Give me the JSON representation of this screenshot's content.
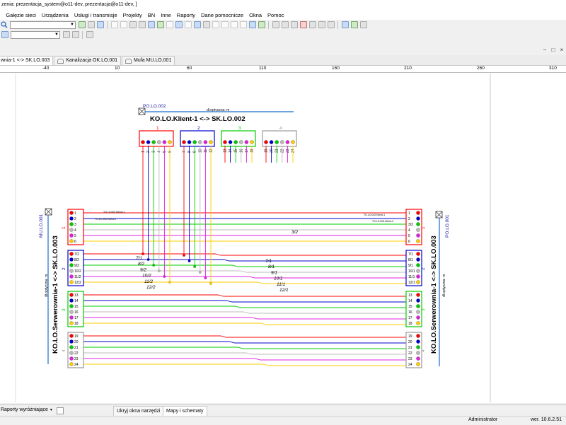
{
  "window": {
    "title": "zenia: prezentacja_system@o11-dev, prezentacja@o11-dev, ]"
  },
  "menu": [
    "ji",
    "Gałęzie sieci",
    "Urządzenia",
    "Usługi i transmisje",
    "Projekty",
    "BN",
    "Inne",
    "Raporty",
    "Dane pomocnicze",
    "Okna",
    "Pomoc"
  ],
  "tabs": [
    {
      "label": "wnia-1 <-> SK.LO.003"
    },
    {
      "label": "Kanalizacja OK.LO.001"
    },
    {
      "label": "Mufa MU.LO.001"
    }
  ],
  "ruler": [
    "-40",
    "10",
    "60",
    "110",
    "160",
    "210",
    "260",
    "310"
  ],
  "diagram": {
    "top_po": "PO.LO.002",
    "top_cable_note": "dł.optyczna: m",
    "top_cable_name": "KO.LO.Klient-1 <-> SK.LO.002",
    "top_tubes": [
      {
        "label": "1",
        "color": "#ff0000",
        "fibers": [
          "1",
          "2",
          "3",
          "4",
          "5",
          "6"
        ]
      },
      {
        "label": "2",
        "color": "#0000cc",
        "fibers": [
          "7",
          "8",
          "9",
          "10",
          "11",
          "12"
        ]
      },
      {
        "label": "3",
        "color": "#00cc00",
        "fibers": [
          "13",
          "14",
          "15",
          "16",
          "17",
          "18"
        ]
      },
      {
        "label": "4",
        "color": "#999999",
        "fibers": [
          "19",
          "20",
          "21",
          "22",
          "23",
          "24"
        ]
      }
    ],
    "left_mu": "MU.LO.001",
    "left_note": "dł.optyczna: m",
    "left_cable_name": "KO.LO.Serwerownia-1 <-> SK.LO.003",
    "right_po": "PO.LO.001",
    "right_note": "dł.optyczna: m",
    "right_cable_name": "KO.LO.Serwerownia-1 <-> SK.LO.003",
    "left_tubes": [
      {
        "label": "1",
        "color": "#ff0000",
        "fibers": [
          "1",
          "2",
          "3",
          "4",
          "5",
          "6"
        ],
        "side": "3/2"
      },
      {
        "label": "2",
        "color": "#0000cc",
        "fibers": [
          "7/2",
          "8/2",
          "9/2",
          "10/2",
          "11/2",
          "12/2"
        ],
        "side": "7/2 8/2 9/2 10/2 11/2 12/2"
      },
      {
        "label": "3",
        "color": "#00cc00",
        "fibers": [
          "13",
          "14",
          "15",
          "16",
          "17",
          "18"
        ],
        "side": ""
      },
      {
        "label": "4",
        "color": "#999999",
        "fibers": [
          "19",
          "20",
          "21",
          "22",
          "23",
          "24"
        ],
        "side": ""
      }
    ],
    "right_tubes": [
      {
        "label": "1",
        "color": "#ff0000",
        "fibers": [
          "1",
          "2",
          "3/2",
          "4",
          "5",
          "6"
        ]
      },
      {
        "label": "2",
        "color": "#0000cc",
        "fibers": [
          "7/1",
          "8/1",
          "9/1",
          "10/1",
          "11/1",
          "12/1"
        ]
      },
      {
        "label": "3",
        "color": "#00cc00",
        "fibers": [
          "13",
          "14",
          "15",
          "16",
          "17",
          "18"
        ]
      },
      {
        "label": "4",
        "color": "#999999",
        "fibers": [
          "19",
          "20",
          "21",
          "22",
          "23",
          "24"
        ]
      }
    ],
    "small_labels": [
      "TO.LO.002.Klient-1",
      "TO.LO.002.Klient-2",
      "TO.LO.002.Klient-1",
      "TO.LO.002.Klient-2"
    ],
    "splice_labels_left": [
      "7/1",
      "8/2",
      "9/2",
      "10/2",
      "11/2",
      "12/2"
    ],
    "splice_labels_right": [
      "7/1",
      "8/1",
      "9/1",
      "10/1",
      "11/1",
      "12/1"
    ],
    "mid_label": "3/2"
  },
  "fiber_colors": [
    "#ff0000",
    "#0000cc",
    "#00cc00",
    "#bbbbbb",
    "#e020e0",
    "#ffcc00"
  ],
  "bottom": {
    "reports": "Raporty wyróżniające",
    "hide_tools": "Ukryj okna narzędzi",
    "maps": "Mapy i schematy"
  },
  "status": {
    "user": "Administrator",
    "version": "wer. 10.6.2.51"
  }
}
